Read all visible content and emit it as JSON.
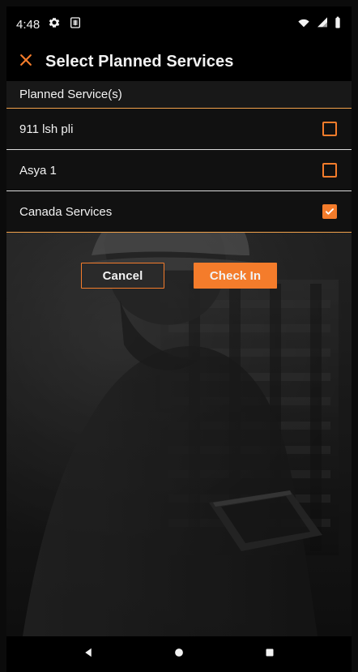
{
  "status_bar": {
    "time": "4:48",
    "icons": [
      "gear-icon",
      "sim-card-icon",
      "wifi-icon",
      "signal-icon",
      "battery-icon"
    ]
  },
  "header": {
    "close_icon": "close-icon",
    "title": "Select Planned Services"
  },
  "main": {
    "section_label": "Planned Service(s)",
    "services": [
      {
        "label": "911 lsh pli",
        "checked": false
      },
      {
        "label": "Asya 1",
        "checked": false
      },
      {
        "label": "Canada Services",
        "checked": true
      }
    ],
    "buttons": {
      "cancel": "Cancel",
      "check_in": "Check In"
    }
  },
  "nav": {
    "icons": [
      "back-icon",
      "home-icon",
      "recents-icon"
    ]
  },
  "colors": {
    "accent": "#f47c2b",
    "header_bg": "#000000",
    "row_bg": "#111111",
    "text": "#f2f2f2",
    "section_divider": "#f2a24b"
  }
}
